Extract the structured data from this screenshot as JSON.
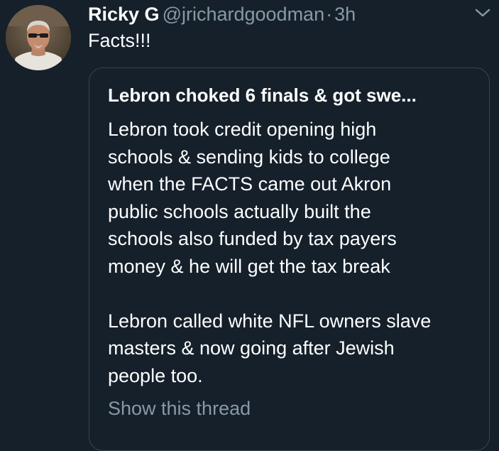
{
  "tweet": {
    "display_name": "Ricky G",
    "handle": "@jrichardgoodman",
    "separator": "·",
    "time": "3h",
    "text": "Facts!!!",
    "avatar_icon": "user-avatar-photo",
    "menu_icon": "chevron-down-icon"
  },
  "quote": {
    "title": "Lebron choked 6 finals & got swe...",
    "paragraph1_lines": [
      "Lebron took credit opening high",
      "schools & sending kids to college",
      "when the FACTS came out Akron",
      "public schools actually built the",
      "schools also funded by tax payers",
      "money & he will get the tax break"
    ],
    "paragraph2_lines": [
      "Lebron called white NFL owners slave",
      "masters & now going after Jewish",
      "people too."
    ],
    "show_thread": "Show this thread"
  },
  "colors": {
    "background": "#15202b",
    "text_primary": "#ffffff",
    "text_secondary": "#8899a6",
    "card_border": "#38444d"
  }
}
